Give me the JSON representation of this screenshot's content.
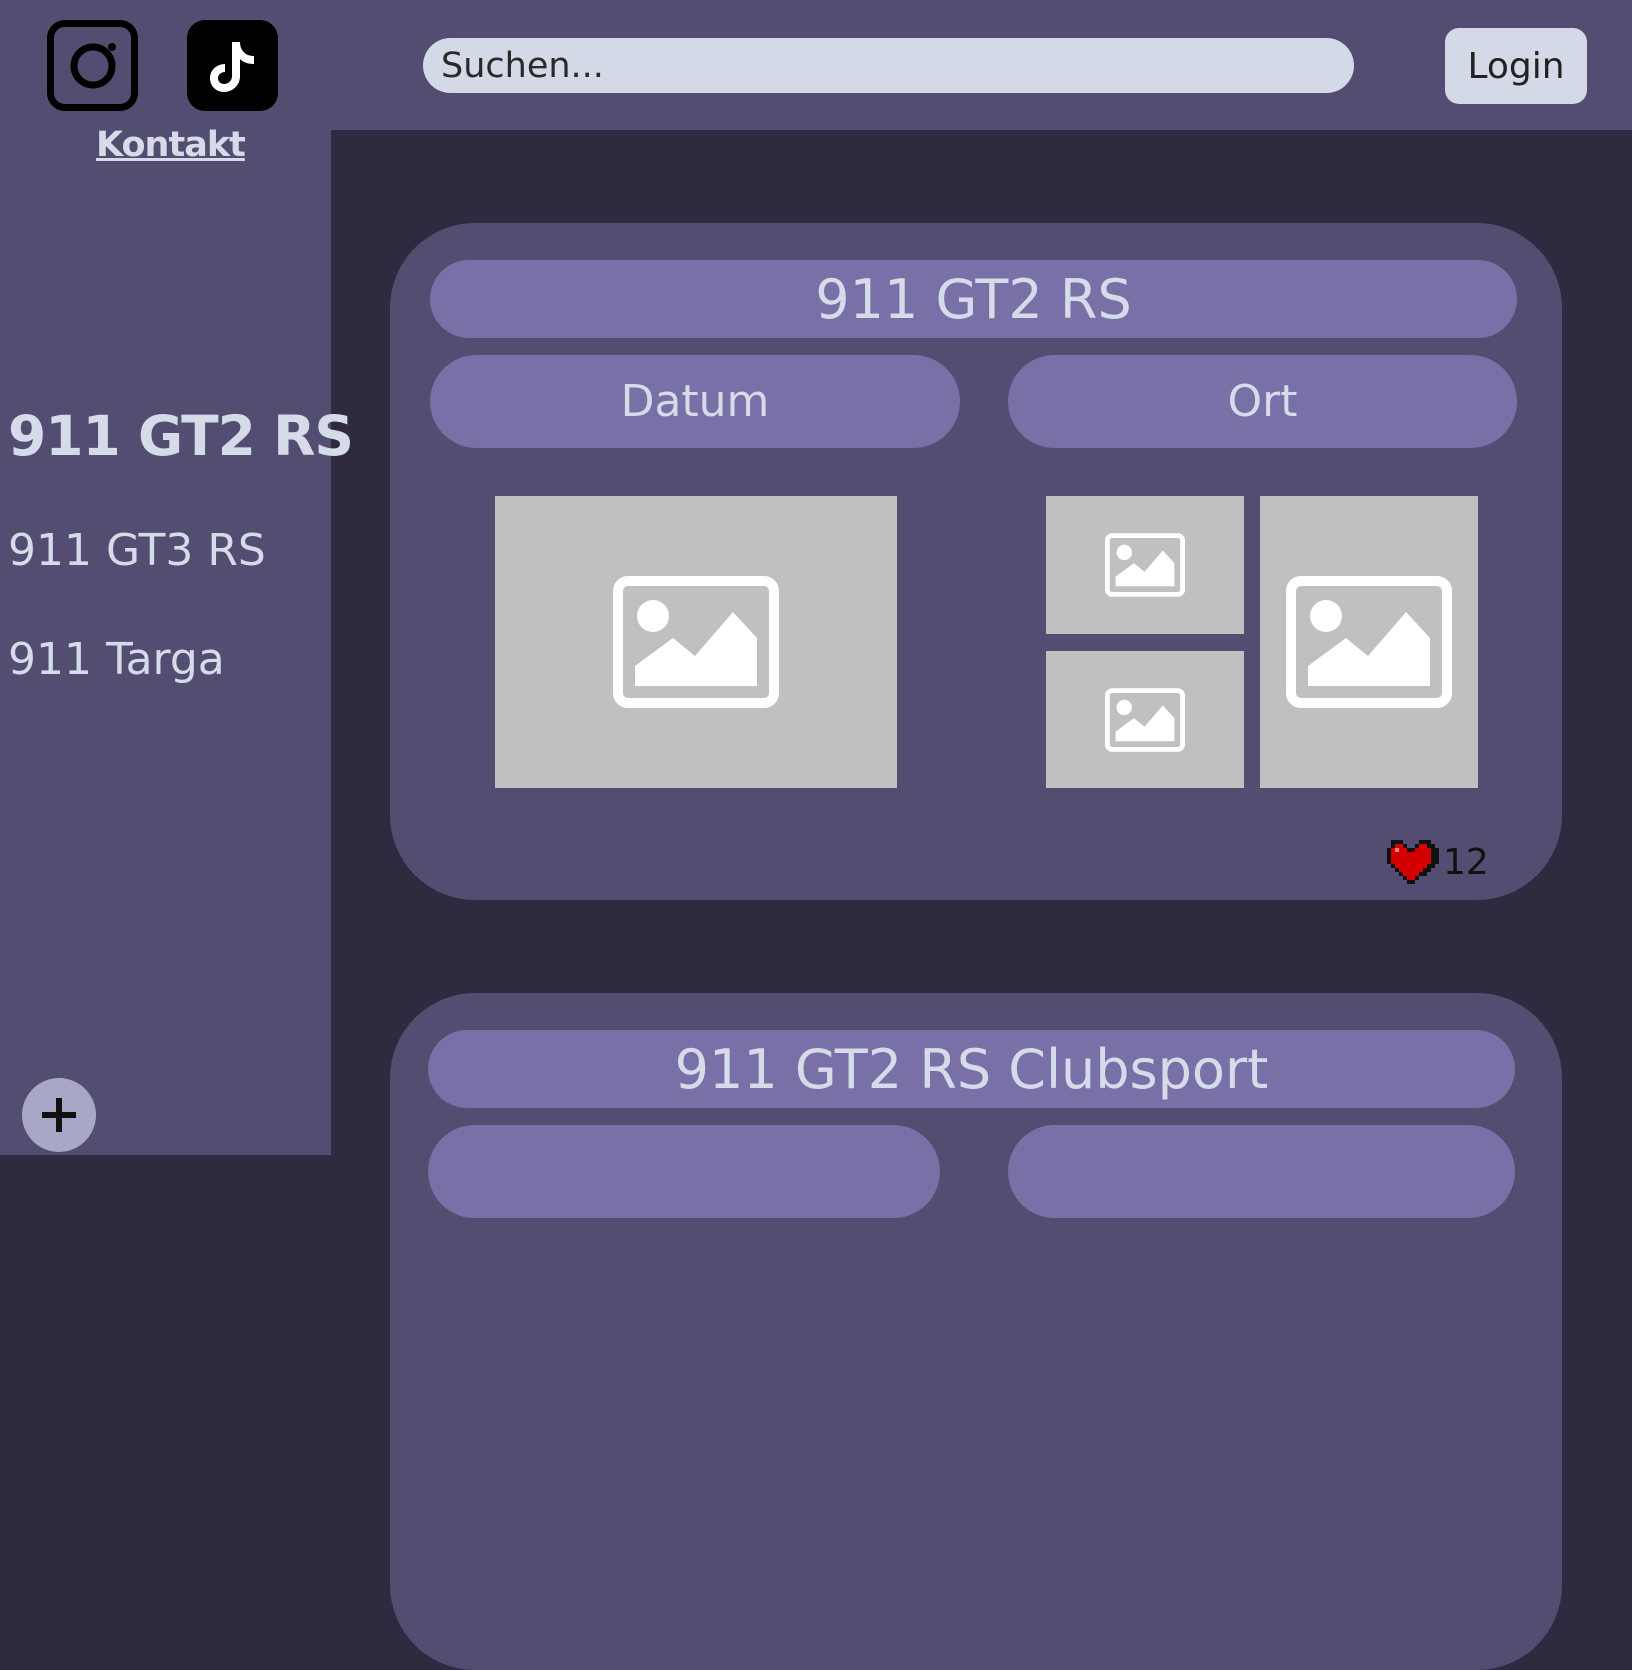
{
  "header": {
    "search_placeholder": "Suchen...",
    "login_label": "Login",
    "contact_label": "Kontakt",
    "social_icons": [
      "instagram-icon",
      "tiktok-icon"
    ]
  },
  "sidebar": {
    "items": [
      {
        "label": "911 GT2 RS",
        "active": true
      },
      {
        "label": "911 GT3 RS",
        "active": false
      },
      {
        "label": "911 Targa",
        "active": false
      }
    ],
    "add_icon": "plus-icon"
  },
  "cards": [
    {
      "title": "911 GT2 RS",
      "date_label": "Datum",
      "place_label": "Ort",
      "likes": "12",
      "like_icon": "heart-icon"
    },
    {
      "title": "911 GT2 RS Clubsport"
    }
  ],
  "colors": {
    "page_bg": "#2f2a3f",
    "panel_bg": "#524d71",
    "pill_bg": "#7870a6",
    "text_light": "#d6dbea",
    "placeholder_bg": "#c0c0c0",
    "heart": "#d40000"
  }
}
